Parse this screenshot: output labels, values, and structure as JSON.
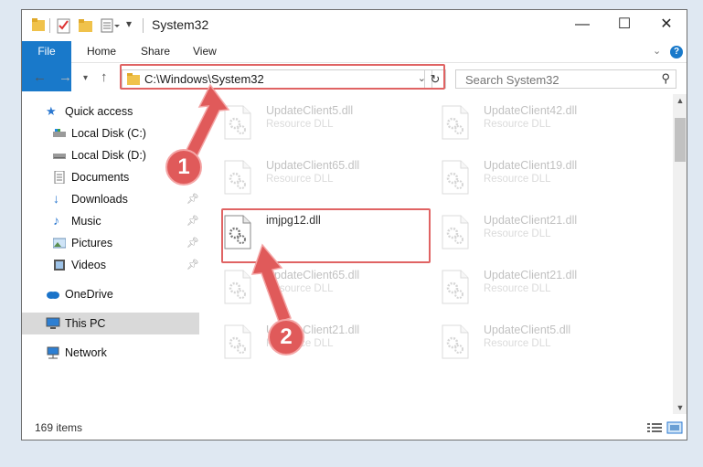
{
  "window": {
    "title": "System32",
    "minimize": "—",
    "maximize": "☐",
    "close": "✕"
  },
  "ribbon": {
    "tabs": [
      "File",
      "Home",
      "Share",
      "View"
    ],
    "help": "?"
  },
  "address": {
    "path": "C:\\Windows\\System32",
    "search_placeholder": "Search System32"
  },
  "nav": {
    "items": [
      {
        "label": "Quick access",
        "icon": "star-icon"
      },
      {
        "label": "Local Disk (C:)",
        "icon": "drive-icon"
      },
      {
        "label": "Local Disk (D:)",
        "icon": "drive-icon"
      },
      {
        "label": "Documents",
        "icon": "documents-icon",
        "pinned": true
      },
      {
        "label": "Downloads",
        "icon": "downloads-icon",
        "pinned": true
      },
      {
        "label": "Music",
        "icon": "music-icon",
        "pinned": true
      },
      {
        "label": "Pictures",
        "icon": "pictures-icon",
        "pinned": true
      },
      {
        "label": "Videos",
        "icon": "videos-icon",
        "pinned": true
      },
      {
        "label": "OneDrive",
        "icon": "cloud-icon"
      },
      {
        "label": "This PC",
        "icon": "computer-icon",
        "selected": true
      },
      {
        "label": "Network",
        "icon": "network-icon"
      }
    ]
  },
  "files": [
    {
      "name": "UpdateClient5.dll",
      "type": "Resource DLL",
      "faded": true
    },
    {
      "name": "UpdateClient42.dll",
      "type": "Resource DLL",
      "faded": true
    },
    {
      "name": "UpdateClient65.dll",
      "type": "Resource DLL",
      "faded": true
    },
    {
      "name": "UpdateClient19.dll",
      "type": "Resource DLL",
      "faded": true
    },
    {
      "name": "imjpg12.dll",
      "type": "",
      "faded": false
    },
    {
      "name": "UpdateClient21.dll",
      "type": "Resource DLL",
      "faded": true
    },
    {
      "name": "UpdateClient65.dll",
      "type": "Resource DLL",
      "faded": true
    },
    {
      "name": "UpdateClient21.dll",
      "type": "Resource DLL",
      "faded": true
    },
    {
      "name": "UpdateClient21.dll",
      "type": "Resource DLL",
      "faded": true
    },
    {
      "name": "UpdateClient5.dll",
      "type": "Resource DLL",
      "faded": true
    }
  ],
  "status": {
    "item_count": "169 items"
  },
  "annotations": {
    "step1": "1",
    "step2": "2",
    "color": "#e05a5a"
  }
}
